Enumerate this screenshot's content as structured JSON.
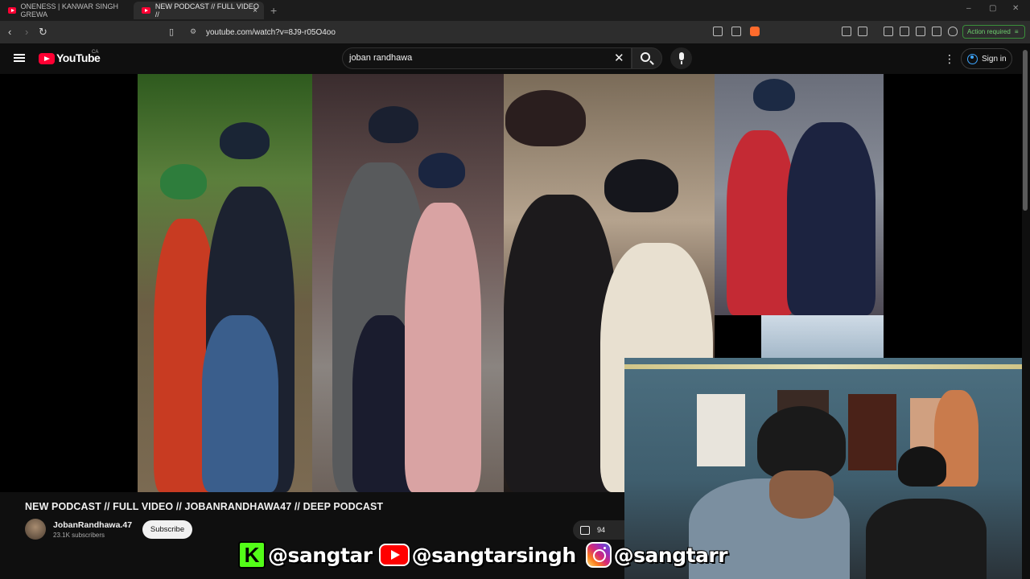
{
  "browser": {
    "tabs": [
      {
        "label": "ONENESS | KANWAR SINGH GREWA",
        "active": false
      },
      {
        "label": "NEW PODCAST // FULL VIDEO //",
        "active": true
      }
    ],
    "new_tab_glyph": "+",
    "close_glyph": "×",
    "url": "youtube.com/watch?v=8J9-r05O4oo",
    "action_required": "Action required",
    "window_controls": [
      "–",
      "▢",
      "✕"
    ]
  },
  "youtube": {
    "logo_text": "YouTube",
    "region": "CA",
    "search_query": "joban randhawa",
    "clear_glyph": "✕",
    "menu_glyph": "⋮",
    "signin_label": "Sign in"
  },
  "video": {
    "title": "NEW PODCAST // FULL VIDEO // JOBANRANDHAWA47 // DEEP PODCAST",
    "channel": "JobanRandhawa.47",
    "subscribers": "23.1K subscribers",
    "subscribe_label": "Subscribe",
    "likes": "94"
  },
  "overlay": {
    "kick_letter": "K",
    "kick_handle": "@sangtar",
    "youtube_handle": "@sangtarsingh",
    "instagram_handle": "@sangtarr"
  },
  "colors": {
    "background": "#0f0f0f",
    "youtube_red": "#ff0033",
    "link_blue": "#3ea6ff",
    "kick_green": "#53fc18"
  }
}
